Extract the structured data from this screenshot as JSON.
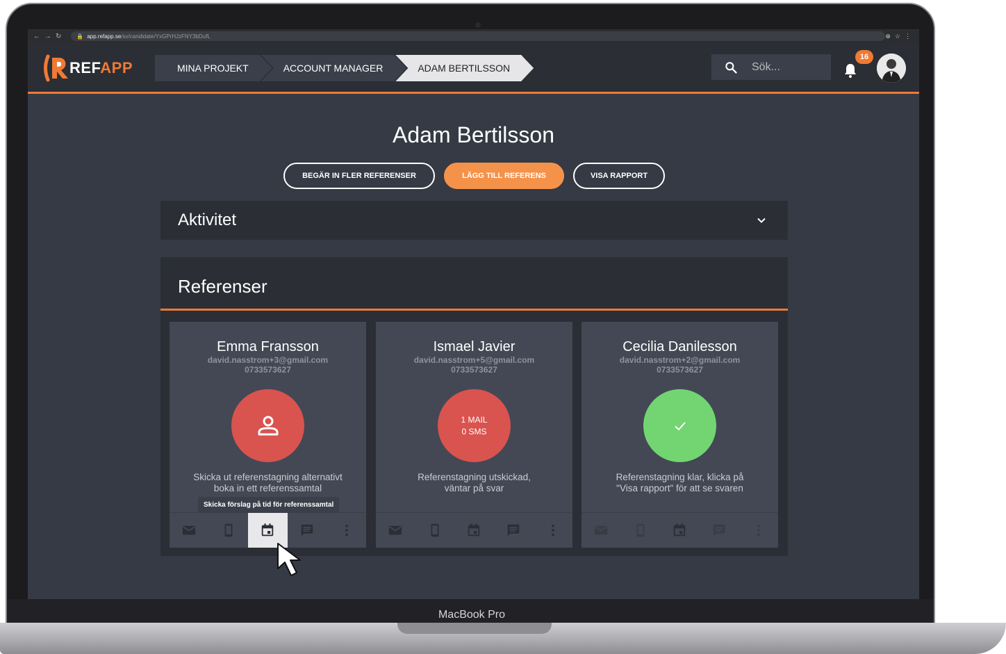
{
  "device": {
    "model_label": "MacBook Pro"
  },
  "browser": {
    "url_host": "app.refapp.se",
    "url_path": "/sv/candidate/YxGPrHJzFNY3bDufL"
  },
  "header": {
    "logo_text_main": "REF",
    "logo_text_accent": "APP",
    "breadcrumb": [
      "MINA PROJEKT",
      "ACCOUNT MANAGER",
      "ADAM BERTILSSON"
    ],
    "search_placeholder": "Sök...",
    "notification_count": "16"
  },
  "page": {
    "title": "Adam Bertilsson",
    "actions": [
      {
        "label": "BEGÄR IN FLER REFERENSER"
      },
      {
        "label": "LÄGG TILL REFERENS"
      },
      {
        "label": "VISA RAPPORT"
      }
    ],
    "activity_title": "Aktivitet",
    "references_title": "Referenser"
  },
  "references": [
    {
      "name": "Emma Fransson",
      "email": "david.nasstrom+3@gmail.com",
      "phone": "0733573627",
      "status_icon": "person-icon",
      "description_line1": "Skicka ut referenstagning alternativt",
      "description_line2": "boka in ett referenssamtal"
    },
    {
      "name": "Ismael Javier",
      "email": "david.nasstrom+5@gmail.com",
      "phone": "0733573627",
      "status_line1": "1 MAIL",
      "status_line2": "0 SMS",
      "description_line1": "Referenstagning utskickad,",
      "description_line2": "väntar på svar"
    },
    {
      "name": "Cecilia Danilesson",
      "email": "david.nasstrom+2@gmail.com",
      "phone": "0733573627",
      "status_icon": "check-icon",
      "description_line1": "Referenstagning klar, klicka på",
      "description_line2": "\"Visa rapport\" för att se svaren"
    }
  ],
  "tooltip": "Skicka förslag på tid för referenssamtal",
  "colors": {
    "accent": "#f07a35",
    "pending": "#d9534f",
    "done": "#72d572",
    "background": "#353a44",
    "panel": "#2b2e35"
  }
}
